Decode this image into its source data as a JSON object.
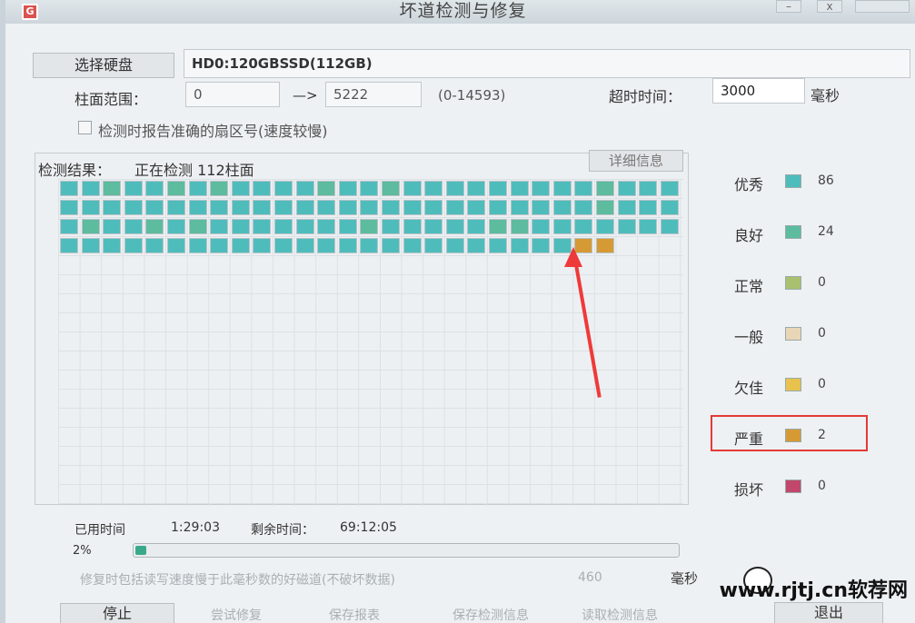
{
  "window": {
    "title": "坏道检测与修复",
    "icon": "app-logo-icon",
    "close": "x",
    "minimize": "–"
  },
  "disk": {
    "select_button": "选择硬盘",
    "name": "HD0:120GBSSD(112GB)"
  },
  "cylinder": {
    "label": "柱面范围：",
    "from": "0",
    "arrow": "—>",
    "to": "5222",
    "range": "(0-14593)"
  },
  "timeout": {
    "label": "超时时间：",
    "value": "3000",
    "unit": "毫秒"
  },
  "option_report_sector": {
    "label": "检测时报告准确的扇区号(速度较慢)",
    "checked": false
  },
  "results": {
    "status_label": "检测结果：",
    "status_text": "正在检测 112柱面",
    "details_button": "详细信息"
  },
  "legend": [
    {
      "label": "优秀",
      "color": "#4fbcbc",
      "count": "86"
    },
    {
      "label": "良好",
      "color": "#5dbb9e",
      "count": "24"
    },
    {
      "label": "正常",
      "color": "#a9c16e",
      "count": "0"
    },
    {
      "label": "一般",
      "color": "#e9d6b6",
      "count": "0"
    },
    {
      "label": "欠佳",
      "color": "#e8c24c",
      "count": "0"
    },
    {
      "label": "严重",
      "color": "#d69a34",
      "count": "2"
    },
    {
      "label": "损坏",
      "color": "#c2476d",
      "count": "0"
    }
  ],
  "cells": {
    "columns": 29,
    "rows": [
      "AABAABABAAAABAABAAAAAAAAABAAAA",
      "AAAAAAAAAAAAAAAAAAAAAAAAABAAAA",
      "ABAABABAAAAAAABAAAAABBAAAAAAAA",
      "AAAAAAAAAAAAAAAAAAAAAAAAXX"
    ],
    "legend_keys": {
      "A": 0,
      "B": 1,
      "X": 5
    }
  },
  "stats": {
    "elapsed_label": "已用时间",
    "elapsed_value": "1:29:03",
    "remaining_label": "剩余时间：",
    "remaining_value": "69:12:05",
    "progress_label": "2%",
    "progress_fraction": 0.02
  },
  "repair_option": {
    "label": "修复时包括读写速度慢于此毫秒数的好磁道(不破坏数据)",
    "value": "460",
    "unit": "毫秒"
  },
  "buttons": {
    "stop": "停止",
    "try_repair": "尝试修复",
    "save_report": "保存报表",
    "save_check": "保存检测信息",
    "read_check": "读取检测信息",
    "exit": "退出"
  },
  "watermark": {
    "text": "www.rjtj.cn软荐网"
  }
}
